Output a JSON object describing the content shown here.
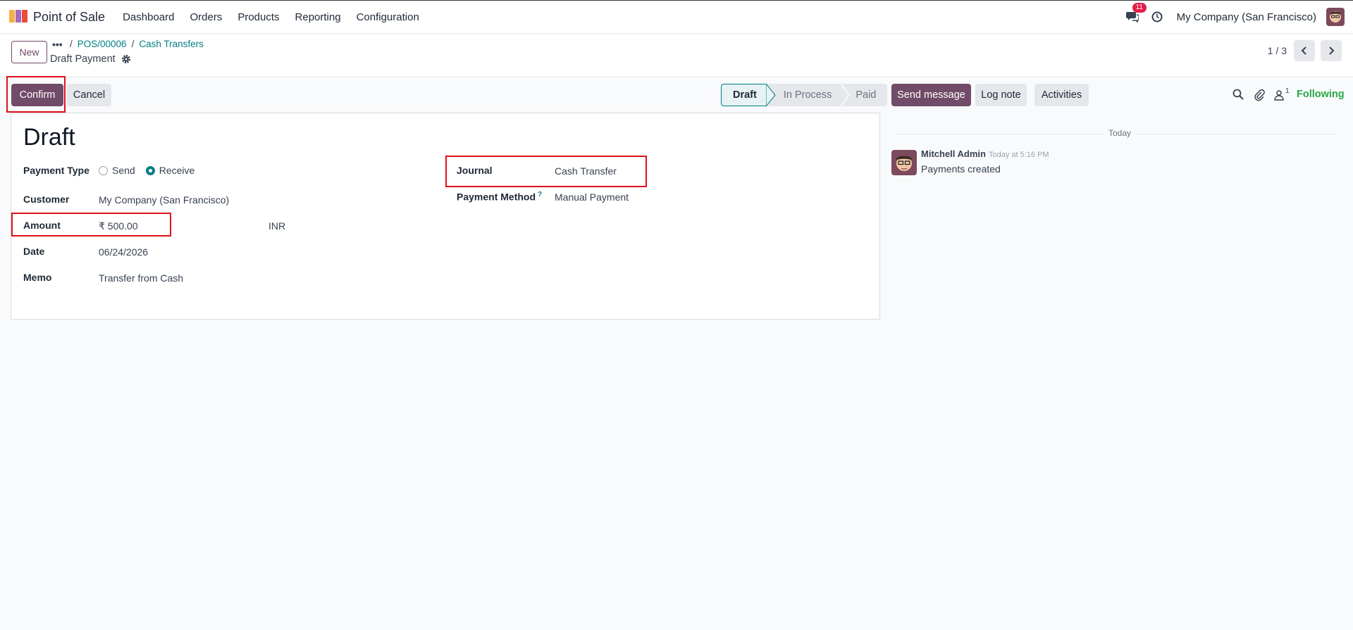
{
  "navbar": {
    "app_name": "Point of Sale",
    "menu": [
      "Dashboard",
      "Orders",
      "Products",
      "Reporting",
      "Configuration"
    ],
    "notification_count": "11",
    "company": "My Company (San Francisco)"
  },
  "control_panel": {
    "new_label": "New",
    "breadcrumb_more": "•••",
    "breadcrumbs": [
      "POS/00006",
      "Cash Transfers"
    ],
    "record_title": "Draft Payment",
    "pager_value": "1 / 3"
  },
  "actions": {
    "confirm_label": "Confirm",
    "cancel_label": "Cancel"
  },
  "statusbar": {
    "stages": [
      "Draft",
      "In Process",
      "Paid"
    ],
    "active_stage": "Draft"
  },
  "form": {
    "state_title": "Draft",
    "payment_type_label": "Payment Type",
    "payment_type_options": [
      "Send",
      "Receive"
    ],
    "payment_type_selected": "Receive",
    "customer_label": "Customer",
    "customer_value": "My Company (San Francisco)",
    "amount_label": "Amount",
    "amount_value": "₹ 500.00",
    "currency_value": "INR",
    "date_label": "Date",
    "date_value": "06/24/2026",
    "memo_label": "Memo",
    "memo_value": "Transfer from Cash",
    "journal_label": "Journal",
    "journal_value": "Cash Transfer",
    "payment_method_label": "Payment Method",
    "payment_method_help": "?",
    "payment_method_value": "Manual Payment"
  },
  "chatter": {
    "send_message_label": "Send message",
    "log_note_label": "Log note",
    "activities_label": "Activities",
    "followers_count": "1",
    "following_label": "Following",
    "date_separator": "Today",
    "messages": [
      {
        "author": "Mitchell Admin",
        "date": "Today at 5:16 PM",
        "body": "Payments created"
      }
    ]
  },
  "colors": {
    "brand": "#714b67",
    "accent": "#017e84",
    "following": "#28a745",
    "highlight": "#e0101a"
  }
}
